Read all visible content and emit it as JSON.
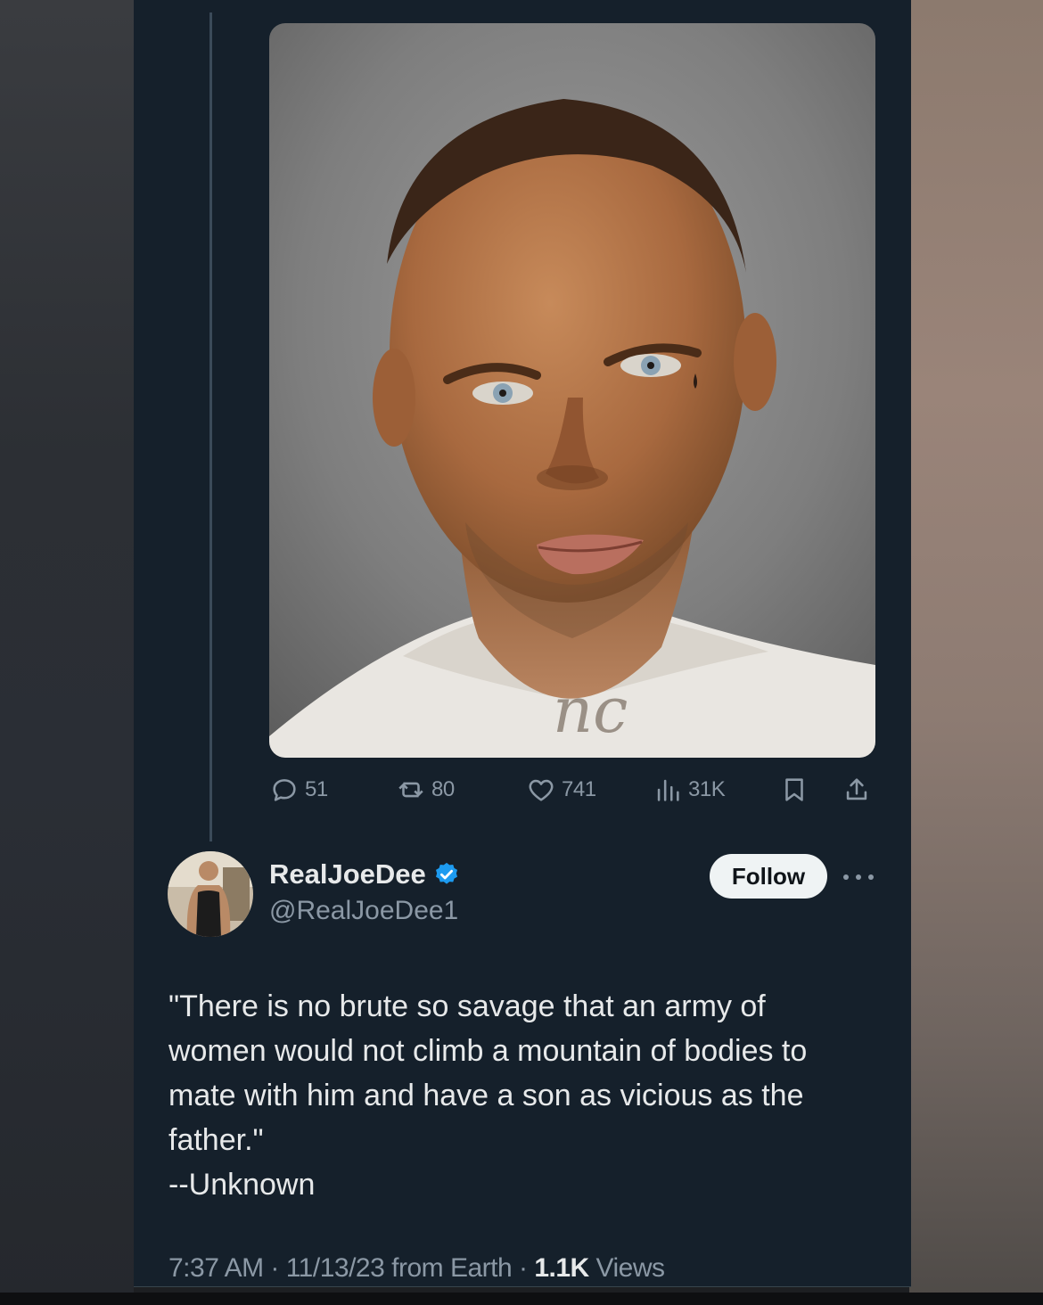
{
  "photo": {
    "description_icon": "mugshot-photo",
    "neck_tattoo_text": "nc"
  },
  "actions": {
    "replies": "51",
    "reposts": "80",
    "likes": "741",
    "views": "31K"
  },
  "author": {
    "display_name": "RealJoeDee",
    "handle": "@RealJoeDee1",
    "verified": true
  },
  "follow_label": "Follow",
  "tweet": {
    "lines": [
      "\"There is no brute so savage that an army of",
      "women would not climb a mountain of bodies to",
      "mate with him and have a son as vicious as the",
      "father.\"",
      "--Unknown"
    ]
  },
  "meta": {
    "prefix": "7:37 AM · 11/13/23 from Earth · ",
    "views_count": "1.1K",
    "views_label": " Views"
  },
  "colors": {
    "background": "#15202b",
    "text_primary": "#e7e9ea",
    "text_secondary": "#8b98a5",
    "verified": "#1d9bf0"
  }
}
